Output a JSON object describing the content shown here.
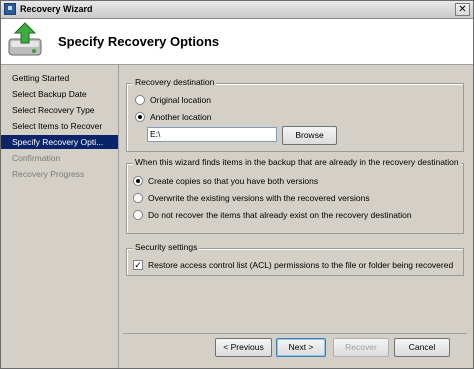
{
  "window": {
    "title": "Recovery Wizard"
  },
  "header": {
    "title": "Specify Recovery Options"
  },
  "nav": {
    "items": [
      {
        "label": "Getting Started"
      },
      {
        "label": "Select Backup Date"
      },
      {
        "label": "Select Recovery Type"
      },
      {
        "label": "Select Items to Recover"
      },
      {
        "label": "Specify Recovery Opti..."
      },
      {
        "label": "Confirmation"
      },
      {
        "label": "Recovery Progress"
      }
    ]
  },
  "destination": {
    "legend": "Recovery destination",
    "original_location": "Original location",
    "another_location": "Another location",
    "path_value": "E:\\",
    "browse_label": "Browse"
  },
  "existing": {
    "legend": "When this wizard finds items in the backup that are already in the recovery destination",
    "create_copies": "Create copies so that you have both versions",
    "overwrite": "Overwrite the existing versions with the recovered versions",
    "do_not_recover": "Do not recover the items that already exist on the recovery destination"
  },
  "security": {
    "legend": "Security settings",
    "restore_acl": "Restore access control list (ACL) permissions to the file or folder being recovered"
  },
  "buttons": {
    "previous": "< Previous",
    "next": "Next >",
    "recover": "Recover",
    "cancel": "Cancel"
  },
  "state": {
    "active_step": "Specify Recovery Opti...",
    "destination_choice": "another_location",
    "existing_choice": "create_copies",
    "restore_acl_checked": true
  },
  "colors": {
    "nav_active_bg": "#0a246a",
    "dialog_bg": "#d4d0c8"
  }
}
